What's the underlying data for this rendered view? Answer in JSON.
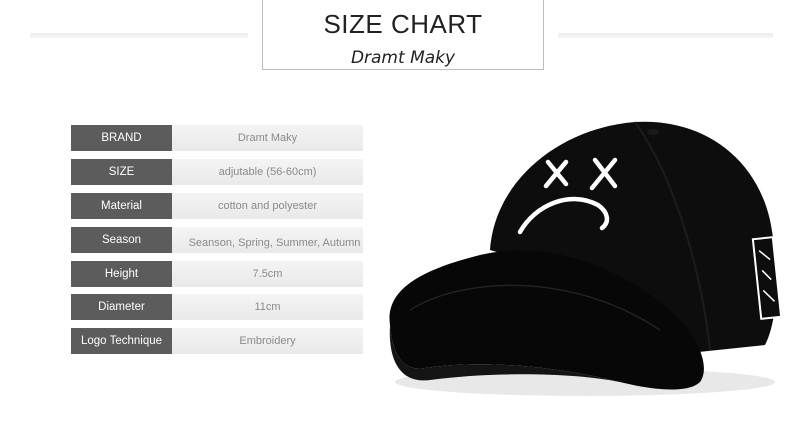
{
  "header": {
    "title": "SIZE CHART",
    "subtitle": "Dramt Maky"
  },
  "specs": [
    {
      "label": "BRAND",
      "value": "Dramt Maky"
    },
    {
      "label": "SIZE",
      "value": "adjutable (56-60cm)"
    },
    {
      "label": "Material",
      "value": "cotton and polyester"
    },
    {
      "label": "Season",
      "value": "Seanson, Spring, Summer, Autumn"
    },
    {
      "label": "Height",
      "value": "7.5cm"
    },
    {
      "label": "Diameter",
      "value": "11cm"
    },
    {
      "label": "Logo Technique",
      "value": "Embroidery"
    }
  ],
  "colors": {
    "label_bg": "#5c5c5c",
    "value_bg": "#eeeeee",
    "cap": "#0b0b0b",
    "embroidery": "#ffffff"
  },
  "image": {
    "subject": "black baseball cap with embroidered face"
  }
}
